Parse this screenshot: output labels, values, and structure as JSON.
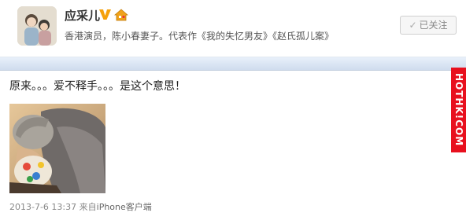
{
  "profile": {
    "name": "应采儿",
    "bio": "香港演员，陈小春妻子。代表作《我的失忆男友》《赵氏孤儿案》",
    "follow_label": "已关注",
    "verified_icon": "verified-v-icon",
    "badge_icon": "house-icon",
    "accent_color": "#f5a10a"
  },
  "post": {
    "text": "原来。。。爱不释手。。。是这个意思！",
    "timestamp": "2013-7-6 13:37",
    "via_prefix": "来自",
    "source": "iPhone客户端"
  },
  "watermark": {
    "text": "HOTHK!COM",
    "color": "#e8101e"
  }
}
